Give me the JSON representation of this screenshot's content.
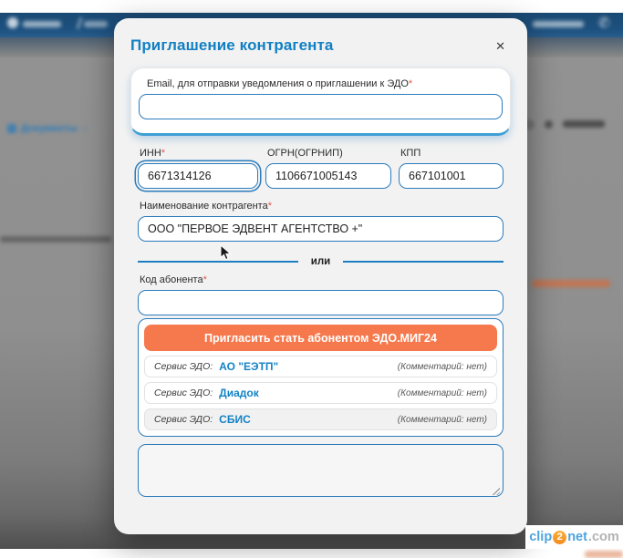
{
  "colors": {
    "accent_blue": "#1180c4",
    "input_border_blue": "#2b7cbd",
    "button_orange": "#f5794d",
    "required_red": "#e2574c",
    "header_navy": "#1d5180"
  },
  "icons": {
    "close": "✕",
    "chevron_down": "∨",
    "phone": "✆"
  },
  "background": {
    "documents_label": "Документы"
  },
  "modal": {
    "title": "Приглашение контрагента",
    "required_mark": "*",
    "email_field": {
      "label": "Email, для отправки уведомления о приглашении к ЭДО",
      "value": ""
    },
    "inn": {
      "label": "ИНН",
      "value": "6671314126"
    },
    "ogrn": {
      "label": "ОГРН(ОГРНИП)",
      "value": "1106671005143"
    },
    "kpp": {
      "label": "КПП",
      "value": "667101001"
    },
    "name": {
      "label": "Наименование контрагента",
      "value": "ООО \"ПЕРВОЕ ЭДВЕНТ АГЕНТСТВО +\""
    },
    "divider_label": "или",
    "abonent_code": {
      "label": "Код абонента",
      "value": ""
    },
    "dropdown": {
      "invite_button": "Пригласить стать абонентом ЭДО.МИГ24",
      "options": [
        {
          "prefix": "Сервис ЭДО:",
          "name": "АО \"ЕЭТП\"",
          "comment": "(Комментарий: нет)"
        },
        {
          "prefix": "Сервис ЭДО:",
          "name": "Диадок",
          "comment": "(Комментарий: нет)"
        },
        {
          "prefix": "Сервис ЭДО:",
          "name": "СБИС",
          "comment": "(Комментарий: нет)"
        }
      ]
    },
    "comment_value": ""
  },
  "watermark": {
    "clip": "clip",
    "two": "2",
    "net": "net",
    "com": ".com"
  }
}
